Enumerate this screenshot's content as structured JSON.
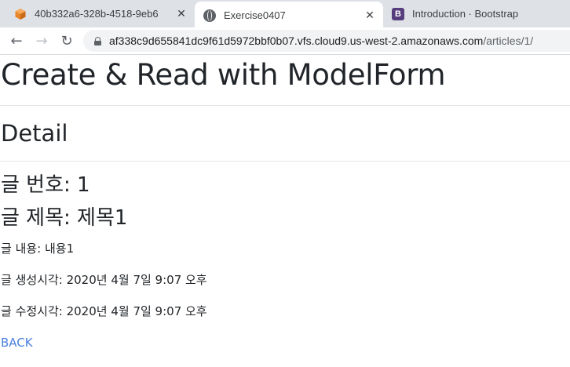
{
  "browser": {
    "tabs": [
      {
        "title": "40b332a6-328b-4518-9eb6",
        "favicon": "aws-cube-icon",
        "close": "✕"
      },
      {
        "title": "Exercise0407",
        "favicon": "globe-icon",
        "close": "✕",
        "active": true
      },
      {
        "title": "Introduction · Bootstrap",
        "favicon": "bootstrap-icon",
        "close": "✕"
      }
    ],
    "url_host": "af338c9d655841dc9f61d5972bbf0b07.vfs.cloud9.us-west-2.amazonaws.com",
    "url_path": "/articles/1/",
    "nav": {
      "back": "←",
      "forward": "→",
      "reload": "↻"
    },
    "bootstrap_letter": "B"
  },
  "page": {
    "heading": "Create & Read with ModelForm",
    "subheading": "Detail",
    "article_number": "글 번호: 1",
    "article_title": "글 제목: 제목1",
    "article_content": "글 내용: 내용1",
    "created_at": "글 생성시각: 2020년 4월 7일 9:07 오후",
    "updated_at": "글 수정시각: 2020년 4월 7일 9:07 오후",
    "back_label": "BACK"
  },
  "colors": {
    "tabstrip_bg": "#dee1e6",
    "link": "#4a7fe0",
    "text": "#212529",
    "aws_orange": "#e8862a",
    "bootstrap_purple": "#563d7c"
  }
}
